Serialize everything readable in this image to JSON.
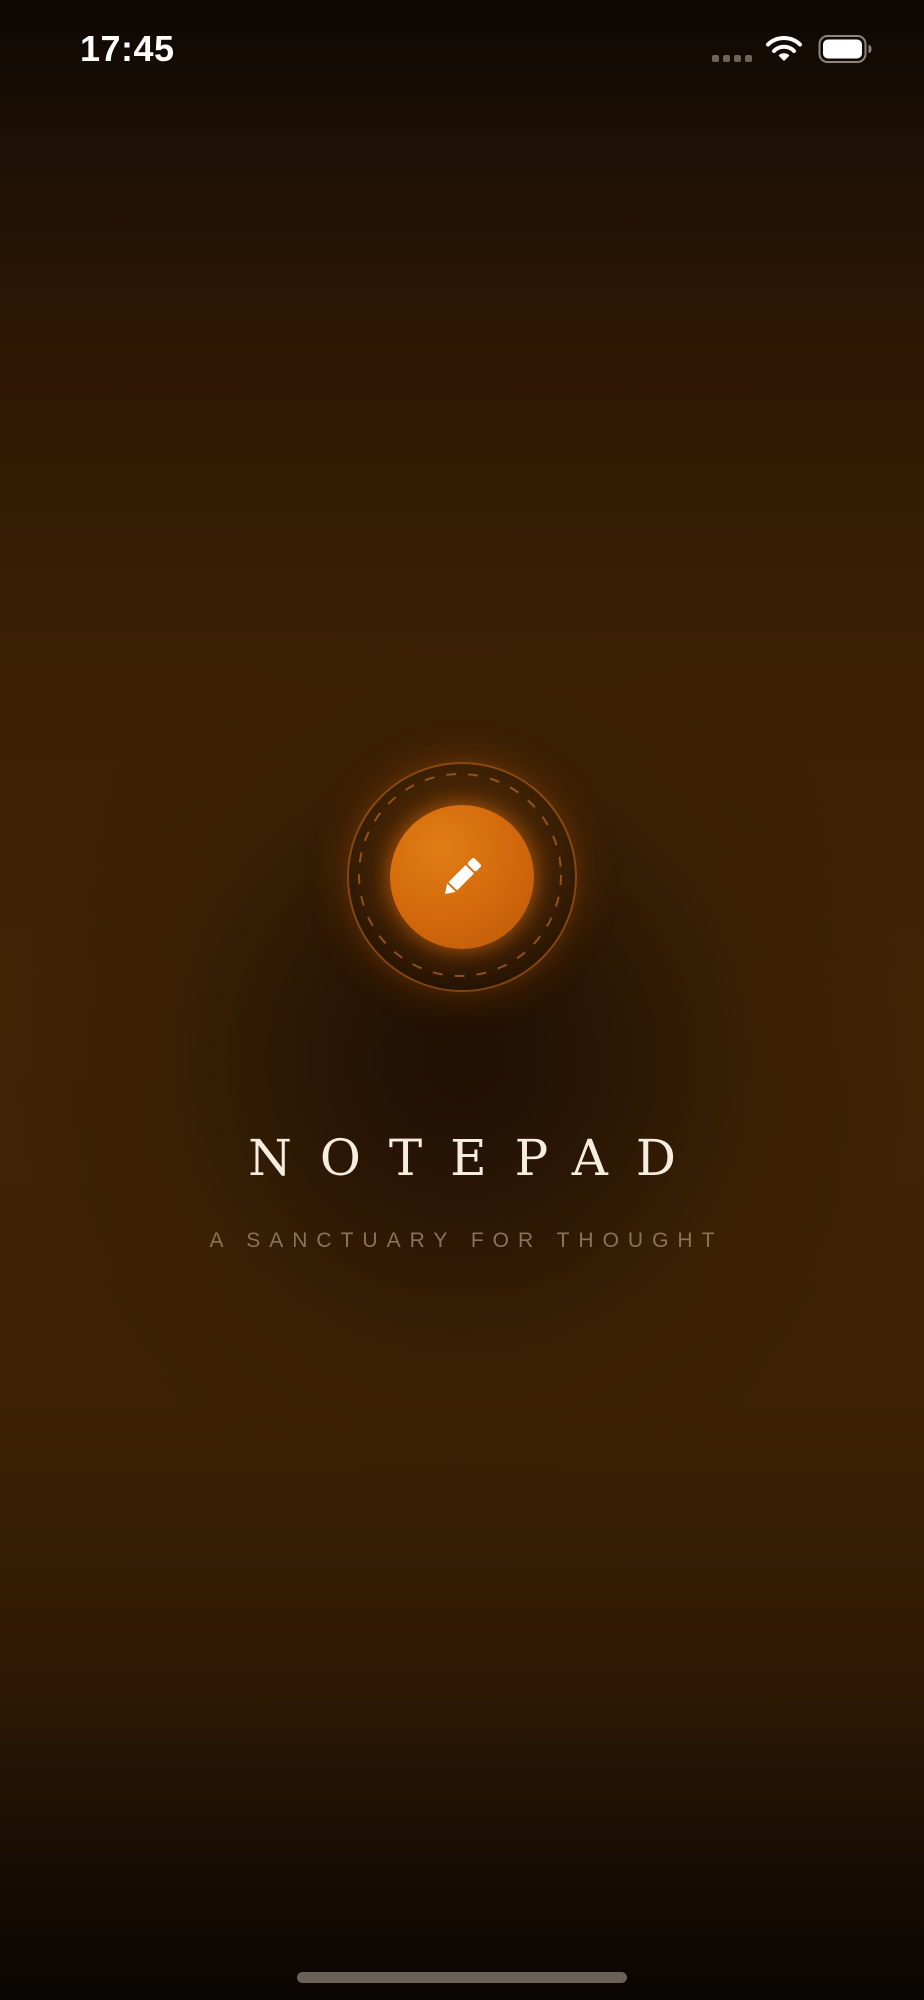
{
  "status_bar": {
    "time": "17:45",
    "signal_icon": "cellular-signal-icon",
    "wifi_icon": "wifi-icon",
    "battery_icon": "battery-icon",
    "battery_level": 1.0
  },
  "splash": {
    "logo_icon": "pencil-icon",
    "title": "NOTEPAD",
    "tagline": "A SANCTUARY FOR THOUGHT"
  },
  "colors": {
    "background": "#3c2105",
    "accent": "#d2680c",
    "title": "#f6ece0",
    "tagline": "#8b7258"
  }
}
